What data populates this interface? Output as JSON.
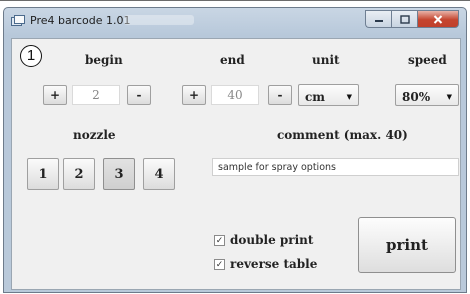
{
  "window": {
    "title": "Pre4 barcode 1.01",
    "minimize_glyph": "—",
    "maximize_glyph": "☐",
    "close_glyph": "✕"
  },
  "badge": "1",
  "labels": {
    "begin": "begin",
    "end": "end",
    "unit": "unit",
    "speed": "speed",
    "nozzle": "nozzle",
    "comment": "comment (max. 40)"
  },
  "begin": {
    "plus": "+",
    "value": "2",
    "minus": "-"
  },
  "end": {
    "plus": "+",
    "value": "40",
    "minus": "-"
  },
  "unit": {
    "selected": "cm",
    "arrow": "▼"
  },
  "speed": {
    "selected": "80%",
    "arrow": "▼"
  },
  "nozzles": [
    "1",
    "2",
    "3",
    "4"
  ],
  "comment_value": "sample for spray options",
  "checkboxes": {
    "double_print": {
      "label": "double print",
      "checked": true,
      "mark": "✓"
    },
    "reverse_table": {
      "label": "reverse table",
      "checked": true,
      "mark": "✓"
    }
  },
  "print_label": "print"
}
